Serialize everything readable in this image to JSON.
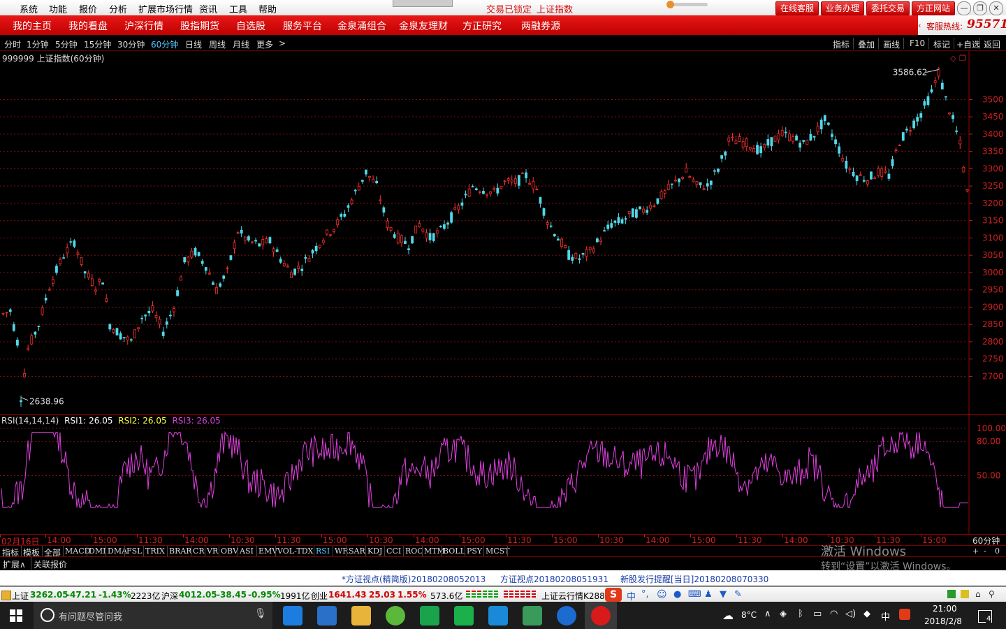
{
  "menubar": {
    "items": [
      "系统",
      "功能",
      "报价",
      "分析",
      "扩展市场行情",
      "资讯",
      "工具",
      "帮助"
    ],
    "center_status": "交易已锁定",
    "center_index": "上证指数",
    "buttons": [
      "在线客服",
      "业务办理",
      "委托交易",
      "方正网站"
    ]
  },
  "nav": {
    "items": [
      "我的主页",
      "我的看盘",
      "沪深行情",
      "股指期货",
      "自选股",
      "服务平台",
      "金泉涌组合",
      "金泉友理财",
      "方正研究",
      "两融券源"
    ],
    "hotline_label": "客服热线:",
    "hotline_number": "95571"
  },
  "periodbar": {
    "periods": [
      "分时",
      "1分钟",
      "5分钟",
      "15分钟",
      "30分钟",
      "60分钟",
      "日线",
      "周线",
      "月线",
      "更多"
    ],
    "active": "60分钟",
    "more_arrow": ">",
    "tools": [
      "指标",
      "叠加",
      "画线",
      "F10",
      "标记",
      "+自选",
      "返回"
    ]
  },
  "chart": {
    "title": "999999 上证指数(60分钟)",
    "high_label": "3586.62",
    "low_label": "2638.96",
    "rsi_title": "RSI(14,14,14)",
    "rsi1": "RSI1: 26.05",
    "rsi2": "RSI2: 26.05",
    "rsi3": "RSI3: 26.05",
    "period_label": "60分钟",
    "date_label": "02月16日"
  },
  "chart_data": {
    "type": "candlestick",
    "ylim": [
      2600,
      3620
    ],
    "y_ticks": [
      2700,
      2750,
      2800,
      2850,
      2900,
      2950,
      3000,
      3050,
      3100,
      3150,
      3200,
      3250,
      3300,
      3350,
      3400,
      3450,
      3500
    ],
    "rsi_ticks": [
      50.0,
      80.0,
      100.0
    ],
    "rsi_ylim": [
      0,
      100
    ],
    "time_labels": [
      "02月16日",
      "14:00",
      "15:00",
      "11:30",
      "14:00",
      "10:30",
      "11:30",
      "15:00",
      "10:30",
      "14:00",
      "15:00",
      "11:30",
      "15:00",
      "10:30",
      "14:00",
      "15:00",
      "11:30",
      "14:00",
      "10:30",
      "11:30",
      "15:00"
    ],
    "trend": [
      [
        0,
        2880
      ],
      [
        2,
        2890
      ],
      [
        4,
        2800
      ],
      [
        5,
        2640
      ],
      [
        7,
        2780
      ],
      [
        10,
        2850
      ],
      [
        13,
        2960
      ],
      [
        17,
        3050
      ],
      [
        20,
        3090
      ],
      [
        23,
        3000
      ],
      [
        26,
        2960
      ],
      [
        28,
        2980
      ],
      [
        30,
        2850
      ],
      [
        33,
        2820
      ],
      [
        36,
        2800
      ],
      [
        39,
        2870
      ],
      [
        42,
        2890
      ],
      [
        45,
        2830
      ],
      [
        48,
        2900
      ],
      [
        51,
        3030
      ],
      [
        54,
        3060
      ],
      [
        57,
        3020
      ],
      [
        60,
        2950
      ],
      [
        63,
        3000
      ],
      [
        66,
        3120
      ],
      [
        69,
        3090
      ],
      [
        72,
        3080
      ],
      [
        75,
        3090
      ],
      [
        78,
        3040
      ],
      [
        81,
        3000
      ],
      [
        84,
        3020
      ],
      [
        87,
        3060
      ],
      [
        90,
        3100
      ],
      [
        93,
        3130
      ],
      [
        96,
        3170
      ],
      [
        99,
        3230
      ],
      [
        102,
        3290
      ],
      [
        105,
        3250
      ],
      [
        108,
        3140
      ],
      [
        111,
        3100
      ],
      [
        114,
        3080
      ],
      [
        117,
        3140
      ],
      [
        120,
        3100
      ],
      [
        123,
        3120
      ],
      [
        126,
        3160
      ],
      [
        129,
        3200
      ],
      [
        132,
        3250
      ],
      [
        135,
        3240
      ],
      [
        138,
        3230
      ],
      [
        141,
        3260
      ],
      [
        144,
        3260
      ],
      [
        147,
        3280
      ],
      [
        150,
        3240
      ],
      [
        153,
        3150
      ],
      [
        156,
        3100
      ],
      [
        159,
        3050
      ],
      [
        162,
        3040
      ],
      [
        165,
        3060
      ],
      [
        168,
        3100
      ],
      [
        171,
        3140
      ],
      [
        174,
        3150
      ],
      [
        177,
        3170
      ],
      [
        180,
        3180
      ],
      [
        183,
        3200
      ],
      [
        186,
        3230
      ],
      [
        189,
        3260
      ],
      [
        192,
        3290
      ],
      [
        195,
        3250
      ],
      [
        198,
        3250
      ],
      [
        201,
        3300
      ],
      [
        204,
        3380
      ],
      [
        207,
        3380
      ],
      [
        210,
        3370
      ],
      [
        213,
        3350
      ],
      [
        216,
        3380
      ],
      [
        219,
        3400
      ],
      [
        222,
        3390
      ],
      [
        225,
        3370
      ],
      [
        228,
        3400
      ],
      [
        231,
        3440
      ],
      [
        234,
        3380
      ],
      [
        237,
        3310
      ],
      [
        240,
        3280
      ],
      [
        243,
        3270
      ],
      [
        246,
        3290
      ],
      [
        249,
        3280
      ],
      [
        252,
        3380
      ],
      [
        255,
        3420
      ],
      [
        258,
        3460
      ],
      [
        261,
        3520
      ],
      [
        263,
        3580
      ],
      [
        265,
        3500
      ],
      [
        267,
        3440
      ],
      [
        269,
        3370
      ],
      [
        271,
        3230
      ]
    ],
    "count": 272
  },
  "indtabs": {
    "items": [
      "指标",
      "模板",
      "全部",
      "MACD",
      "DMI",
      "DMA",
      "FSL",
      "TRIX",
      "BRAR",
      "CR",
      "VR",
      "OBV",
      "ASI",
      "EMV",
      "VOL-TDX",
      "RSI",
      "WR",
      "SAR",
      "KDJ",
      "CCI",
      "ROC",
      "MTM",
      "BOLL",
      "PSY",
      "MCST"
    ],
    "active": "RSI",
    "right": [
      "+",
      "-",
      "0"
    ]
  },
  "expandrow": {
    "items": [
      "扩展∧",
      "关联报价"
    ]
  },
  "watermark": {
    "line1": "激活 Windows",
    "line2": "转到“设置”以激活 Windows。"
  },
  "news": [
    "*方证视点(精简版)20180208052013",
    "方证视点20180208051931",
    "新股发行提醒[当日]20180208070330"
  ],
  "status": {
    "sh_name": "上证",
    "sh_val": "3262.05",
    "sh_chg": "-47.21",
    "sh_pct": "-1.43%",
    "sh_amt": "2223亿",
    "hs_name": "沪深",
    "hs_val": "4012.05",
    "hs_chg": "-38.45",
    "hs_pct": "-0.95%",
    "hs_amt": "1991亿",
    "cy_name": "创业",
    "cy_val": "1641.43",
    "cy_chg": "25.03",
    "cy_pct": "1.55%",
    "cy_amt": "573.6亿",
    "cloud": "上证云行情K288",
    "ime": "中"
  },
  "taskbar": {
    "search_placeholder": "有问题尽管问我",
    "temp": "8°C",
    "ime": "中",
    "time": "21:00",
    "date": "2018/2/8",
    "notif_count": "4"
  }
}
